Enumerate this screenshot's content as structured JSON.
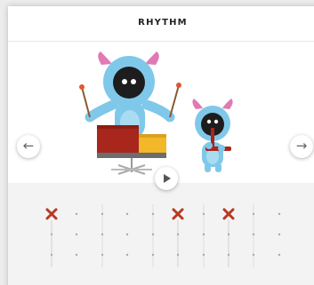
{
  "title": "RHYTHM",
  "nav": {
    "prev_icon": "arrow-left-icon",
    "next_icon": "arrow-right-icon",
    "play_icon": "play-icon"
  },
  "characters": [
    {
      "name": "big-monster-drummer",
      "body_color": "#80c8ea",
      "horn_color": "#e07ab5"
    },
    {
      "name": "small-monster-flute",
      "body_color": "#80c8ea",
      "horn_color": "#e07ab5"
    }
  ],
  "instruments": {
    "drum_red": "#a8261b",
    "drum_yellow": "#f2b829"
  },
  "sequencer": {
    "columns": 8,
    "rows": 3,
    "active_color": "#b63a22",
    "row_hits": [
      [
        true,
        false,
        false,
        false,
        false,
        true,
        false,
        true
      ],
      [
        false,
        false,
        false,
        false,
        false,
        false,
        false,
        false
      ],
      [
        false,
        false,
        false,
        false,
        false,
        false,
        false,
        false
      ]
    ]
  }
}
